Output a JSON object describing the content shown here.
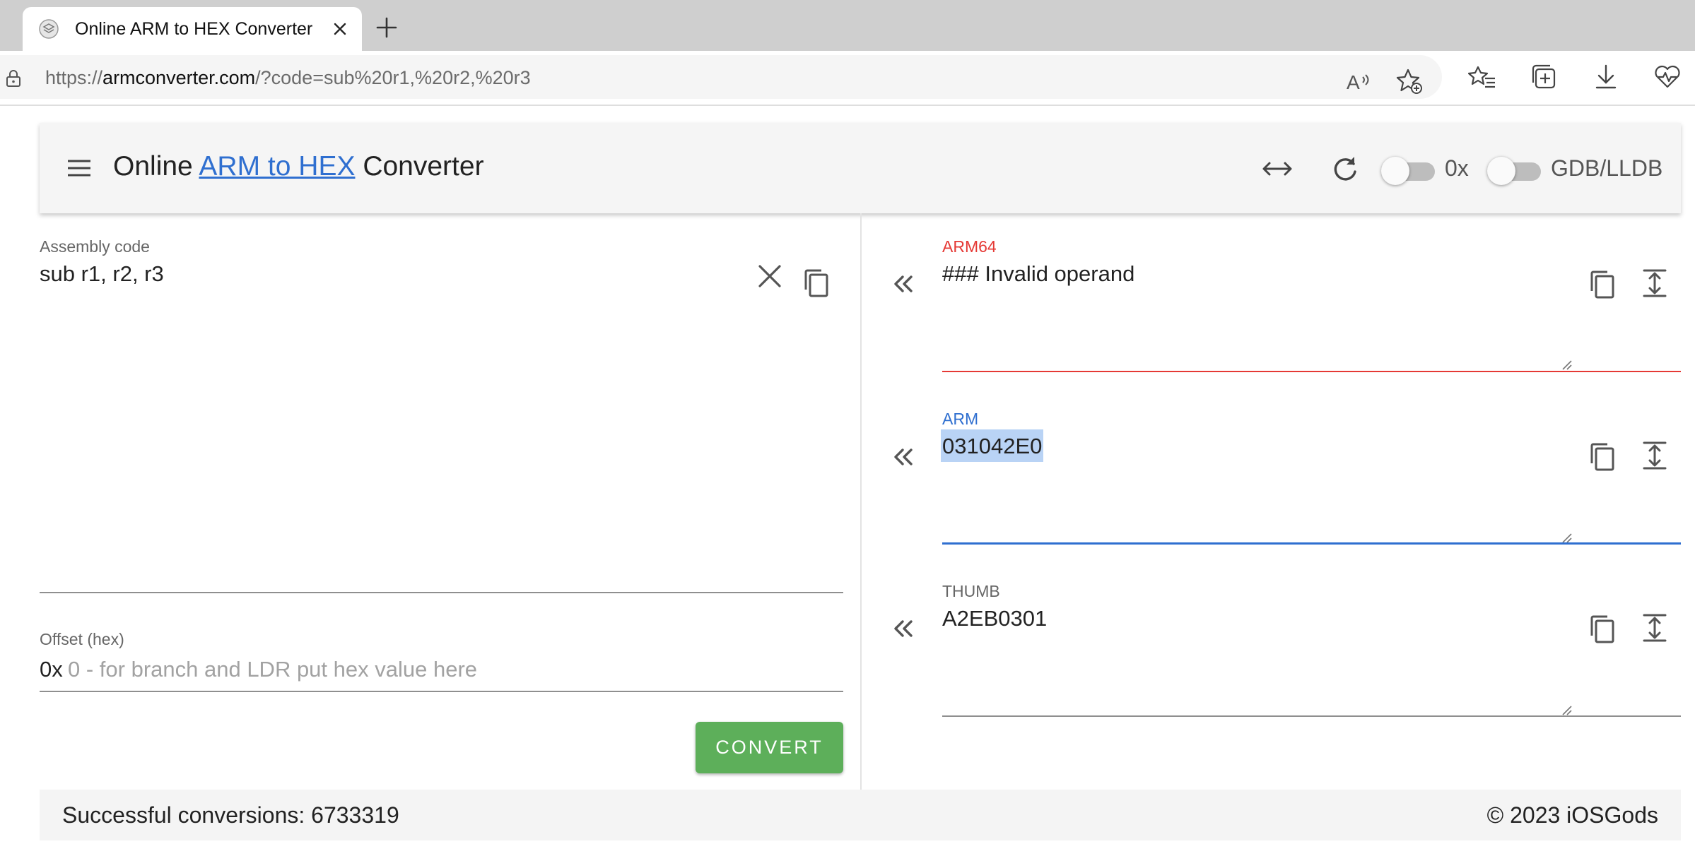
{
  "browser": {
    "tab_title": "Online ARM to HEX Converter",
    "url_scheme": "https://",
    "url_host": "armconverter.com",
    "url_path": "/?code=sub%20r1,%20r2,%20r3",
    "icons": [
      "lock-icon",
      "read-aloud-icon",
      "add-favorite-icon",
      "favorites-icon",
      "collections-icon",
      "download-icon",
      "health-icon"
    ]
  },
  "header": {
    "title_prefix": "Online ",
    "title_link": "ARM to HEX",
    "title_suffix": " Converter",
    "toggle_hex_label": "0x",
    "toggle_debugger_label": "GDB/LLDB"
  },
  "assembly": {
    "label": "Assembly code",
    "value": "sub r1, r2, r3"
  },
  "offset": {
    "label": "Offset (hex)",
    "prefix": "0x",
    "placeholder": "0 - for branch and LDR put hex value here"
  },
  "convert_label": "CONVERT",
  "outputs": [
    {
      "label": "ARM64",
      "value": "### Invalid operand",
      "color": "#e53935"
    },
    {
      "label": "ARM",
      "value": "031042E0",
      "color": "#2f6fd0"
    },
    {
      "label": "THUMB",
      "value": "A2EB0301",
      "color": "#666666"
    }
  ],
  "footer": {
    "conversions": "Successful conversions: 6733319",
    "copyright": "© 2023 iOSGods"
  }
}
